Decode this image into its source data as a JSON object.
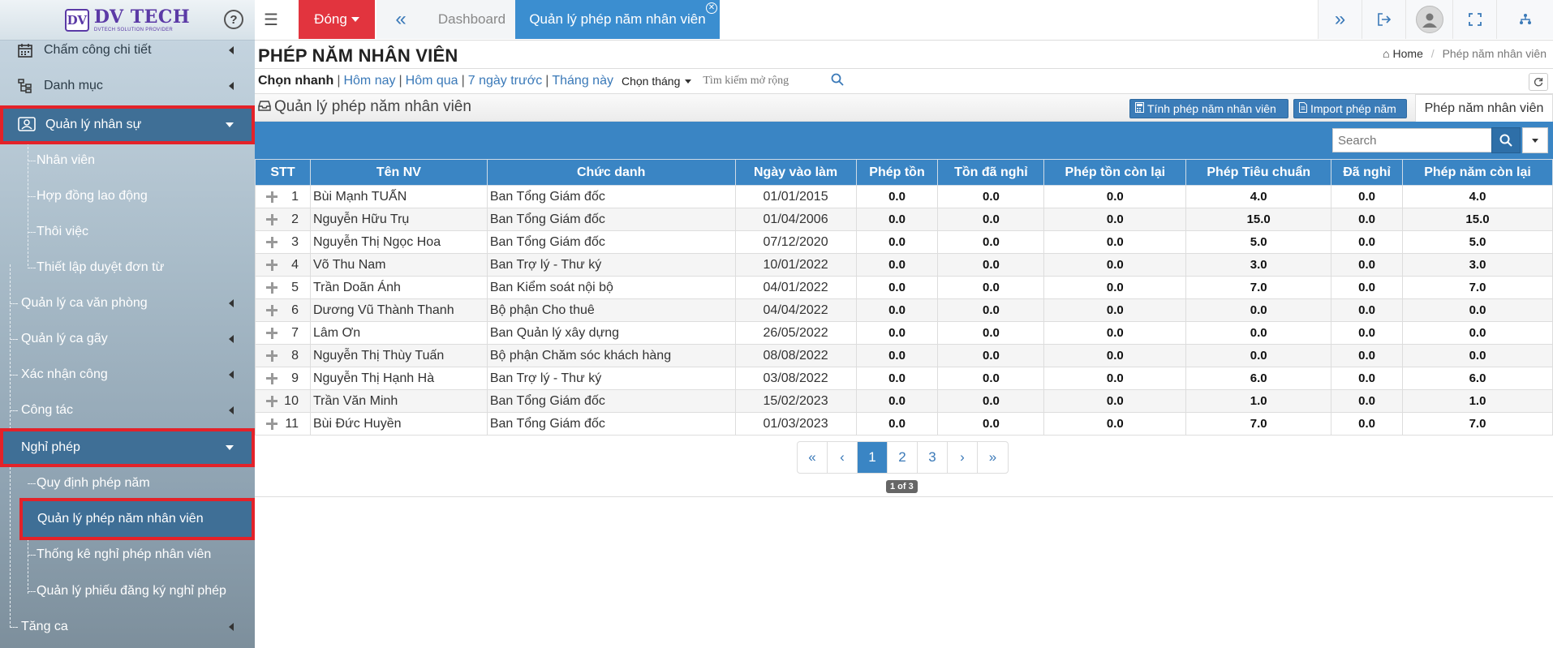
{
  "sidebar": {
    "logo_title": "DV TECH",
    "logo_sub": "DVTECH SOLUTION PROVIDER",
    "logo_mark": "DV",
    "help": "?",
    "items": [
      {
        "label": "Chấm công chi tiết",
        "icon": "calendar-icon"
      },
      {
        "label": "Danh mục",
        "icon": "sitemap-icon"
      },
      {
        "label": "Quản lý nhân sự",
        "icon": "user-card-icon"
      },
      {
        "label": "Nhân viên"
      },
      {
        "label": "Hợp đồng lao động"
      },
      {
        "label": "Thôi việc"
      },
      {
        "label": "Thiết lập duyệt đơn từ"
      },
      {
        "label": "Quản lý ca văn phòng"
      },
      {
        "label": "Quản lý ca gãy"
      },
      {
        "label": "Xác nhận công"
      },
      {
        "label": "Công tác"
      },
      {
        "label": "Nghỉ phép"
      },
      {
        "label": "Quy định phép năm"
      },
      {
        "label": "Quản lý phép năm nhân viên"
      },
      {
        "label": "Thống kê nghỉ phép nhân viên"
      },
      {
        "label": "Quản lý phiếu đăng ký nghỉ phép"
      },
      {
        "label": "Tăng ca"
      }
    ]
  },
  "topbar": {
    "dong_label": "Đóng",
    "tab_dashboard": "Dashboard",
    "tab_active": "Quản lý phép năm nhân viên"
  },
  "page": {
    "title": "PHÉP NĂM NHÂN VIÊN",
    "breadcrumb_home": "Home",
    "breadcrumb_current": "Phép năm nhân viên"
  },
  "filters": {
    "quick": "Chọn nhanh",
    "links": [
      "Hôm nay",
      "Hôm qua",
      "7 ngày trước",
      "Tháng này"
    ],
    "choose_month": "Chọn tháng",
    "ext_search_placeholder": "Tìm kiếm mở rộng"
  },
  "panel": {
    "title": "Quản lý phép năm nhân viên",
    "btn_calc": "Tính phép năm nhân viên",
    "btn_import": "Import phép năm",
    "tab": "Phép năm nhân viên"
  },
  "grid": {
    "search_placeholder": "Search",
    "columns": [
      "STT",
      "Tên NV",
      "Chức danh",
      "Ngày vào làm",
      "Phép tồn",
      "Tồn đã nghỉ",
      "Phép tồn còn lại",
      "Phép Tiêu chuẩn",
      "Đã nghỉ",
      "Phép năm còn lại"
    ],
    "rows": [
      [
        "1",
        "Bùi Mạnh TUẤN",
        "Ban Tổng Giám đốc",
        "01/01/2015",
        "0.0",
        "0.0",
        "0.0",
        "4.0",
        "0.0",
        "4.0"
      ],
      [
        "2",
        "Nguyễn Hữu Trụ",
        "Ban Tổng Giám đốc",
        "01/04/2006",
        "0.0",
        "0.0",
        "0.0",
        "15.0",
        "0.0",
        "15.0"
      ],
      [
        "3",
        "Nguyễn Thị Ngọc Hoa",
        "Ban Tổng Giám đốc",
        "07/12/2020",
        "0.0",
        "0.0",
        "0.0",
        "5.0",
        "0.0",
        "5.0"
      ],
      [
        "4",
        "Võ Thu Nam",
        "Ban Trợ lý - Thư ký",
        "10/01/2022",
        "0.0",
        "0.0",
        "0.0",
        "3.0",
        "0.0",
        "3.0"
      ],
      [
        "5",
        "Trần Doãn Ánh",
        "Ban Kiểm soát nội bộ",
        "04/01/2022",
        "0.0",
        "0.0",
        "0.0",
        "7.0",
        "0.0",
        "7.0"
      ],
      [
        "6",
        "Dương Vũ Thành Thanh",
        "Bộ phận Cho thuê",
        "04/04/2022",
        "0.0",
        "0.0",
        "0.0",
        "0.0",
        "0.0",
        "0.0"
      ],
      [
        "7",
        "Lâm Ơn",
        "Ban Quản lý xây dựng",
        "26/05/2022",
        "0.0",
        "0.0",
        "0.0",
        "0.0",
        "0.0",
        "0.0"
      ],
      [
        "8",
        "Nguyễn Thị Thùy Tuấn",
        "Bộ phận Chăm sóc khách hàng",
        "08/08/2022",
        "0.0",
        "0.0",
        "0.0",
        "0.0",
        "0.0",
        "0.0"
      ],
      [
        "9",
        "Nguyễn Thị Hạnh Hà",
        "Ban Trợ lý - Thư ký",
        "03/08/2022",
        "0.0",
        "0.0",
        "0.0",
        "6.0",
        "0.0",
        "6.0"
      ],
      [
        "10",
        "Trần Văn Minh",
        "Ban Tổng Giám đốc",
        "15/02/2023",
        "0.0",
        "0.0",
        "0.0",
        "1.0",
        "0.0",
        "1.0"
      ],
      [
        "11",
        "Bùi Đức Huyền",
        "Ban Tổng Giám đốc",
        "01/03/2023",
        "0.0",
        "0.0",
        "0.0",
        "7.0",
        "0.0",
        "7.0"
      ]
    ]
  },
  "pager": {
    "buttons": [
      "«",
      "‹",
      "1",
      "2",
      "3",
      "›",
      "»"
    ],
    "active_page": "1",
    "info": "1 of 3"
  }
}
